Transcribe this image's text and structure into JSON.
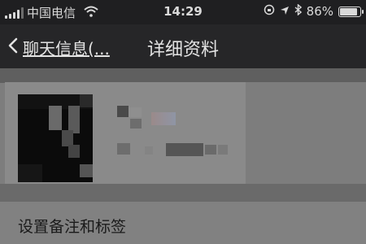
{
  "status_bar": {
    "carrier": "中国电信",
    "time": "14:29",
    "battery_percent": "86%",
    "battery_level": 0.86
  },
  "nav": {
    "back_label": "聊天信息(...",
    "title": "详细资料"
  },
  "settings": {
    "remark_label": "设置备注和标签"
  }
}
